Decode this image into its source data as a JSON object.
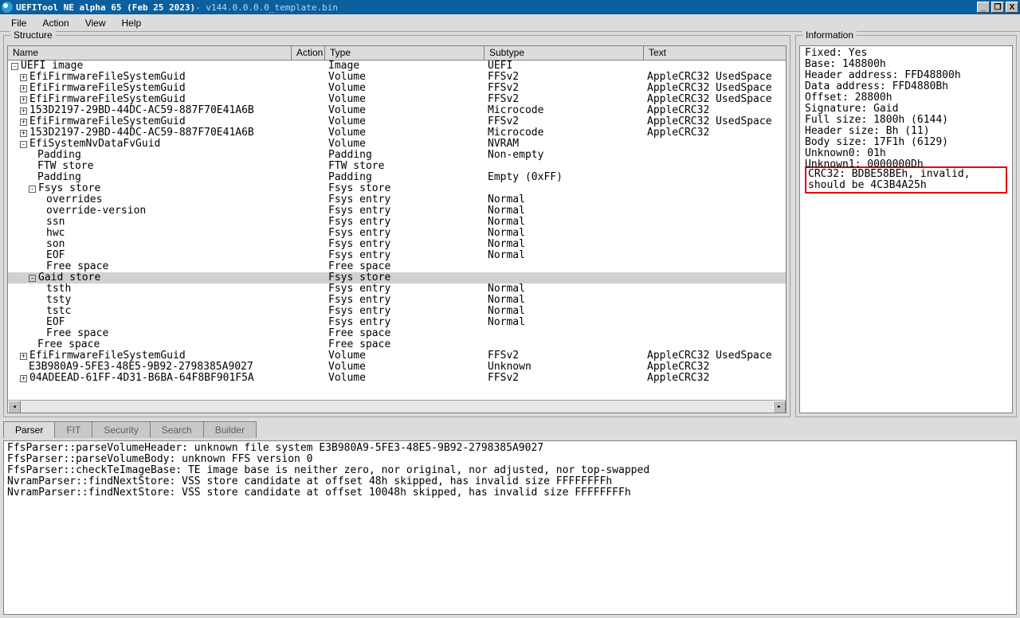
{
  "title": {
    "app": "UEFITool NE alpha 65 (Feb 25 2023)",
    "file": " - v144.0.0.0.0_template.bin"
  },
  "window_buttons": {
    "min": "_",
    "max": "❐",
    "close": "X"
  },
  "menu": [
    "File",
    "Action",
    "View",
    "Help"
  ],
  "groupbox": {
    "structure": "Structure",
    "information": "Information"
  },
  "columns": {
    "name": "Name",
    "action": "Action",
    "type": "Type",
    "subtype": "Subtype",
    "text": "Text"
  },
  "tree": [
    {
      "d": 0,
      "exp": "-",
      "name": "UEFI image",
      "type": "Image",
      "sub": "UEFI",
      "text": ""
    },
    {
      "d": 1,
      "exp": "+",
      "name": "EfiFirmwareFileSystemGuid",
      "type": "Volume",
      "sub": "FFSv2",
      "text": "AppleCRC32 UsedSpace"
    },
    {
      "d": 1,
      "exp": "+",
      "name": "EfiFirmwareFileSystemGuid",
      "type": "Volume",
      "sub": "FFSv2",
      "text": "AppleCRC32 UsedSpace"
    },
    {
      "d": 1,
      "exp": "+",
      "name": "EfiFirmwareFileSystemGuid",
      "type": "Volume",
      "sub": "FFSv2",
      "text": "AppleCRC32 UsedSpace"
    },
    {
      "d": 1,
      "exp": "+",
      "name": "153D2197-29BD-44DC-AC59-887F70E41A6B",
      "type": "Volume",
      "sub": "Microcode",
      "text": "AppleCRC32"
    },
    {
      "d": 1,
      "exp": "+",
      "name": "EfiFirmwareFileSystemGuid",
      "type": "Volume",
      "sub": "FFSv2",
      "text": "AppleCRC32 UsedSpace"
    },
    {
      "d": 1,
      "exp": "+",
      "name": "153D2197-29BD-44DC-AC59-887F70E41A6B",
      "type": "Volume",
      "sub": "Microcode",
      "text": "AppleCRC32"
    },
    {
      "d": 1,
      "exp": "-",
      "name": "EfiSystemNvDataFvGuid",
      "type": "Volume",
      "sub": "NVRAM",
      "text": ""
    },
    {
      "d": 2,
      "exp": "",
      "name": "Padding",
      "type": "Padding",
      "sub": "Non-empty",
      "text": ""
    },
    {
      "d": 2,
      "exp": "",
      "name": "FTW store",
      "type": "FTW store",
      "sub": "",
      "text": ""
    },
    {
      "d": 2,
      "exp": "",
      "name": "Padding",
      "type": "Padding",
      "sub": "Empty (0xFF)",
      "text": ""
    },
    {
      "d": 2,
      "exp": "-",
      "name": "Fsys store",
      "type": "Fsys store",
      "sub": "",
      "text": ""
    },
    {
      "d": 3,
      "exp": "",
      "name": "overrides",
      "type": "Fsys entry",
      "sub": "Normal",
      "text": ""
    },
    {
      "d": 3,
      "exp": "",
      "name": "override-version",
      "type": "Fsys entry",
      "sub": "Normal",
      "text": ""
    },
    {
      "d": 3,
      "exp": "",
      "name": "ssn",
      "type": "Fsys entry",
      "sub": "Normal",
      "text": ""
    },
    {
      "d": 3,
      "exp": "",
      "name": "hwc",
      "type": "Fsys entry",
      "sub": "Normal",
      "text": ""
    },
    {
      "d": 3,
      "exp": "",
      "name": "son",
      "type": "Fsys entry",
      "sub": "Normal",
      "text": ""
    },
    {
      "d": 3,
      "exp": "",
      "name": "EOF",
      "type": "Fsys entry",
      "sub": "Normal",
      "text": ""
    },
    {
      "d": 3,
      "exp": "",
      "name": "Free space",
      "type": "Free space",
      "sub": "",
      "text": ""
    },
    {
      "d": 2,
      "exp": "-",
      "name": "Gaid store",
      "type": "Fsys store",
      "sub": "",
      "text": "",
      "sel": true
    },
    {
      "d": 3,
      "exp": "",
      "name": "tsth",
      "type": "Fsys entry",
      "sub": "Normal",
      "text": ""
    },
    {
      "d": 3,
      "exp": "",
      "name": "tsty",
      "type": "Fsys entry",
      "sub": "Normal",
      "text": ""
    },
    {
      "d": 3,
      "exp": "",
      "name": "tstc",
      "type": "Fsys entry",
      "sub": "Normal",
      "text": ""
    },
    {
      "d": 3,
      "exp": "",
      "name": "EOF",
      "type": "Fsys entry",
      "sub": "Normal",
      "text": ""
    },
    {
      "d": 3,
      "exp": "",
      "name": "Free space",
      "type": "Free space",
      "sub": "",
      "text": ""
    },
    {
      "d": 2,
      "exp": "",
      "name": "Free space",
      "type": "Free space",
      "sub": "",
      "text": ""
    },
    {
      "d": 1,
      "exp": "+",
      "name": "EfiFirmwareFileSystemGuid",
      "type": "Volume",
      "sub": "FFSv2",
      "text": "AppleCRC32 UsedSpace"
    },
    {
      "d": 1,
      "exp": "",
      "name": "E3B980A9-5FE3-48E5-9B92-2798385A9027",
      "type": "Volume",
      "sub": "Unknown",
      "text": "AppleCRC32"
    },
    {
      "d": 1,
      "exp": "+",
      "name": "04ADEEAD-61FF-4D31-B6BA-64F8BF901F5A",
      "type": "Volume",
      "sub": "FFSv2",
      "text": "AppleCRC32"
    }
  ],
  "info": {
    "lines": [
      "Fixed: Yes",
      "Base: 148800h",
      "Header address: FFD48800h",
      "Data address: FFD4880Bh",
      "Offset: 28800h",
      "Signature: Gaid",
      "Full size: 1800h (6144)",
      "Header size: Bh (11)",
      "Body size: 17F1h (6129)",
      "Unknown0: 01h",
      "Unknown1: 0000000Dh"
    ],
    "highlight": "CRC32: BDBE58BEh, invalid, should be 4C3B4A25h"
  },
  "tabs": [
    "Parser",
    "FIT",
    "Security",
    "Search",
    "Builder"
  ],
  "active_tab": 0,
  "log": [
    "FfsParser::parseVolumeHeader: unknown file system E3B980A9-5FE3-48E5-9B92-2798385A9027",
    "FfsParser::parseVolumeBody: unknown FFS version 0",
    "FfsParser::checkTeImageBase: TE image base is neither zero, nor original, nor adjusted, nor top-swapped",
    "NvramParser::findNextStore: VSS store candidate at offset 48h skipped, has invalid size FFFFFFFFh",
    "NvramParser::findNextStore: VSS store candidate at offset 10048h skipped, has invalid size FFFFFFFFh"
  ]
}
